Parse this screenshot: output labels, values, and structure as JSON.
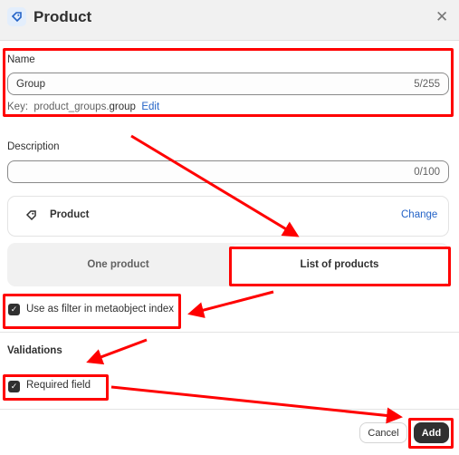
{
  "header": {
    "title": "Product",
    "icon": "product-tag-icon",
    "close_icon": "close-icon"
  },
  "name_field": {
    "label": "Name",
    "value": "Group",
    "count": "5/255",
    "key_label": "Key:",
    "key_prefix": "product_groups.",
    "key_suffix": "group",
    "edit_label": "Edit"
  },
  "description_field": {
    "label": "Description",
    "value": "",
    "count": "0/100"
  },
  "reference": {
    "type_label": "Product",
    "change_label": "Change"
  },
  "cardinality": {
    "options": [
      "One product",
      "List of products"
    ],
    "selected": "List of products"
  },
  "filter_checkbox": {
    "label": "Use as filter in metaobject index",
    "checked": true
  },
  "validations": {
    "heading": "Validations",
    "required_label": "Required field",
    "required_checked": true
  },
  "footer": {
    "cancel_label": "Cancel",
    "add_label": "Add"
  },
  "annotation_color": "#ff0000"
}
